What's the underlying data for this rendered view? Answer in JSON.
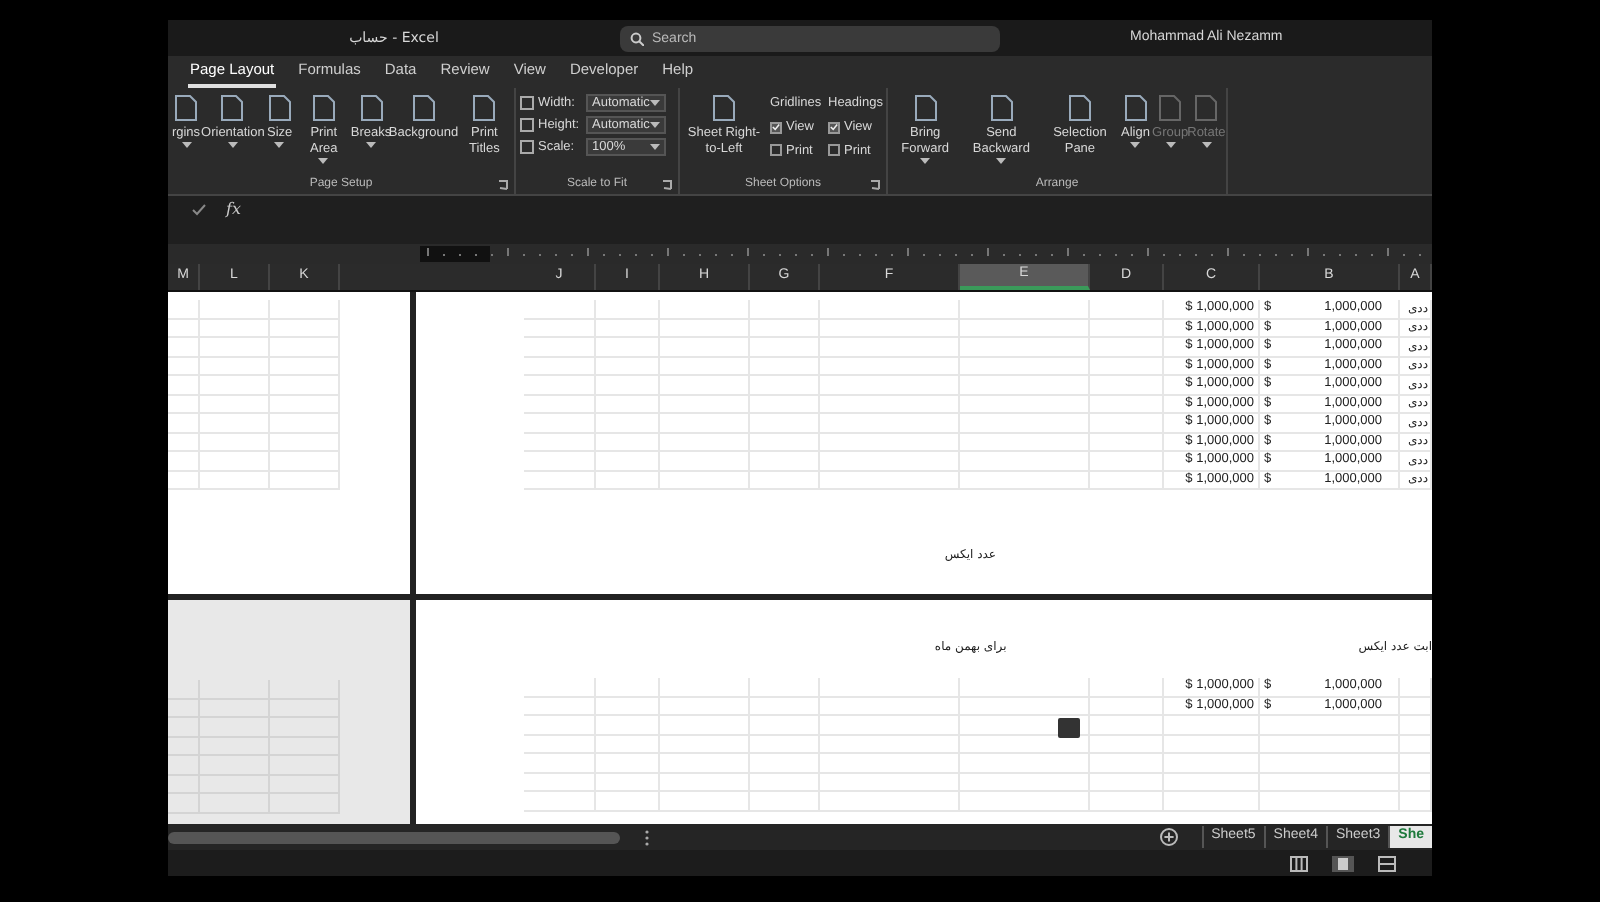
{
  "window": {
    "title": "حساب - Excel"
  },
  "search": {
    "placeholder": "Search"
  },
  "user": {
    "name": "Mohammad Ali Nezamm"
  },
  "tabs": [
    {
      "label": "Page Layout",
      "selected": true
    },
    {
      "label": "Formulas",
      "selected": false
    },
    {
      "label": "Data",
      "selected": false
    },
    {
      "label": "Review",
      "selected": false
    },
    {
      "label": "View",
      "selected": false
    },
    {
      "label": "Developer",
      "selected": false
    },
    {
      "label": "Help",
      "selected": false
    }
  ],
  "ribbon": {
    "groups": [
      {
        "label": "Page Setup",
        "launcher": true,
        "controls": [
          {
            "kind": "big",
            "label": "rgins",
            "dropdown": true,
            "disabled": false
          },
          {
            "kind": "big",
            "label": "Orientation",
            "dropdown": true,
            "disabled": false
          },
          {
            "kind": "big",
            "label": "Size",
            "dropdown": true,
            "disabled": false
          },
          {
            "kind": "big",
            "label": "Print Area",
            "dropdown": true,
            "disabled": false
          },
          {
            "kind": "big",
            "label": "Breaks",
            "dropdown": true,
            "disabled": false
          },
          {
            "kind": "big",
            "label": "Background",
            "dropdown": false,
            "disabled": false
          },
          {
            "kind": "big",
            "label": "Print Titles",
            "dropdown": false,
            "disabled": false
          }
        ]
      },
      {
        "label": "Scale to Fit",
        "launcher": true,
        "controls": [
          {
            "kind": "fields",
            "rows": [
              {
                "label": "Width:",
                "value": "Automatic"
              },
              {
                "label": "Height:",
                "value": "Automatic"
              },
              {
                "label": "Scale:",
                "value": "100%"
              }
            ]
          }
        ]
      },
      {
        "label": "Sheet Options",
        "launcher": true,
        "controls": [
          {
            "kind": "big",
            "label": "Sheet Right-to-Left",
            "dropdown": false,
            "disabled": false
          },
          {
            "kind": "checks",
            "title": "Gridlines",
            "items": [
              {
                "label": "View",
                "checked": true
              },
              {
                "label": "Print",
                "checked": false
              }
            ]
          },
          {
            "kind": "checks",
            "title": "Headings",
            "items": [
              {
                "label": "View",
                "checked": true
              },
              {
                "label": "Print",
                "checked": false
              }
            ]
          }
        ]
      },
      {
        "label": "Arrange",
        "launcher": false,
        "controls": [
          {
            "kind": "big",
            "label": "Bring Forward",
            "dropdown": true,
            "disabled": false
          },
          {
            "kind": "big",
            "label": "Send Backward",
            "dropdown": true,
            "disabled": false
          },
          {
            "kind": "big",
            "label": "Selection Pane",
            "dropdown": false,
            "disabled": false
          },
          {
            "kind": "big",
            "label": "Align",
            "dropdown": true,
            "disabled": false
          },
          {
            "kind": "big",
            "label": "Group",
            "dropdown": true,
            "disabled": true
          },
          {
            "kind": "big",
            "label": "Rotate",
            "dropdown": true,
            "disabled": true
          }
        ]
      }
    ]
  },
  "formula_bar": {
    "function_label": "fx"
  },
  "sheet": {
    "left_columns": [
      "M",
      "L",
      "K"
    ],
    "columns": [
      {
        "label": "J",
        "selected": false
      },
      {
        "label": "I",
        "selected": false
      },
      {
        "label": "H",
        "selected": false
      },
      {
        "label": "G",
        "selected": false
      },
      {
        "label": "F",
        "selected": false
      },
      {
        "label": "E",
        "selected": true
      },
      {
        "label": "D",
        "selected": false
      },
      {
        "label": "C",
        "selected": false
      },
      {
        "label": "B",
        "selected": false
      },
      {
        "label": "A",
        "selected": false
      }
    ],
    "top_page": {
      "rows": [
        {
          "a": "ددی",
          "b_currency": "$",
          "b": "1,000,000",
          "c": "$ 1,000,000"
        },
        {
          "a": "ددی",
          "b_currency": "$",
          "b": "1,000,000",
          "c": "$ 1,000,000"
        },
        {
          "a": "ددی",
          "b_currency": "$",
          "b": "1,000,000",
          "c": "$ 1,000,000"
        },
        {
          "a": "ددی",
          "b_currency": "$",
          "b": "1,000,000",
          "c": "$ 1,000,000"
        },
        {
          "a": "ددی",
          "b_currency": "$",
          "b": "1,000,000",
          "c": "$ 1,000,000"
        },
        {
          "a": "ددی",
          "b_currency": "$",
          "b": "1,000,000",
          "c": "$ 1,000,000"
        },
        {
          "a": "ددی",
          "b_currency": "$",
          "b": "1,000,000",
          "c": "$ 1,000,000"
        },
        {
          "a": "ددی",
          "b_currency": "$",
          "b": "1,000,000",
          "c": "$ 1,000,000"
        },
        {
          "a": "ددی",
          "b_currency": "$",
          "b": "1,000,000",
          "c": "$ 1,000,000"
        },
        {
          "a": "ددی",
          "b_currency": "$",
          "b": "1,000,000",
          "c": "$ 1,000,000"
        }
      ],
      "note": "عدد ایکس"
    },
    "bottom_page": {
      "title_right": "ابت عدد ایکس",
      "title_left": "برای بهمن ماه",
      "rows": [
        {
          "b_currency": "$",
          "b": "1,000,000",
          "c": "$ 1,000,000"
        },
        {
          "b_currency": "$",
          "b": "1,000,000",
          "c": "$ 1,000,000"
        }
      ]
    }
  },
  "sheet_tabs": [
    {
      "label": "Sheet5",
      "selected": false
    },
    {
      "label": "Sheet4",
      "selected": false
    },
    {
      "label": "Sheet3",
      "selected": false
    },
    {
      "label": "She",
      "selected": true
    }
  ]
}
